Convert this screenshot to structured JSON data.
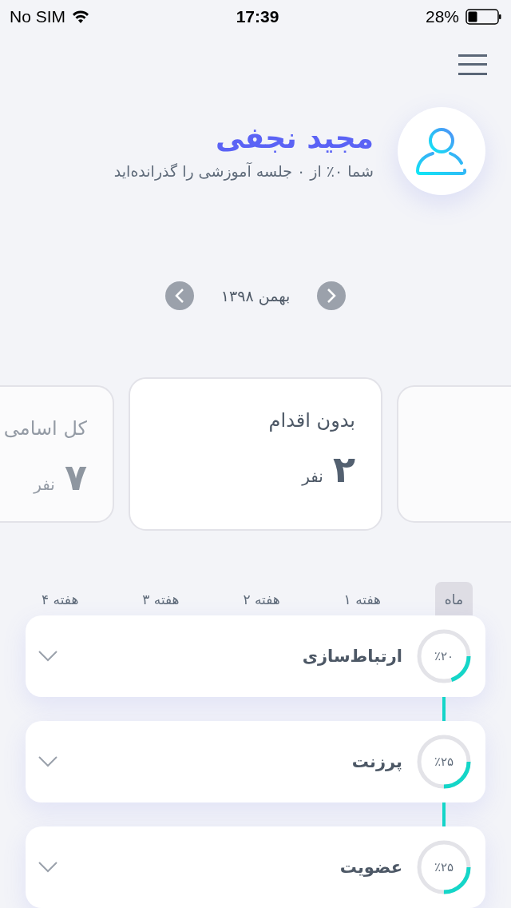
{
  "status_bar": {
    "carrier": "No SIM",
    "time": "17:39",
    "battery": "28%"
  },
  "profile": {
    "name": "مجید نجفی",
    "subtitle": "شما ۰٪ از ۰ جلسه آموزشی را گذرانده‌اید"
  },
  "month_nav": {
    "label": "بهمن ۱۳۹۸"
  },
  "cards": [
    {
      "title": "بدون اقدام",
      "count": "۲",
      "unit": "نفر",
      "selected": true
    },
    {
      "title": "کل اسامی",
      "count": "۷",
      "unit": "نفر",
      "selected": false
    }
  ],
  "tabs": [
    {
      "label": "ماه",
      "selected": true
    },
    {
      "label": "هفته ۱",
      "selected": false
    },
    {
      "label": "هفته ۲",
      "selected": false
    },
    {
      "label": "هفته ۳",
      "selected": false
    },
    {
      "label": "هفته ۴",
      "selected": false
    }
  ],
  "skills": [
    {
      "title": "ارتباط‌سازی",
      "percent": "٪۲۰",
      "level": 0.2
    },
    {
      "title": "پرزنت",
      "percent": "٪۲۵",
      "level": 0.25
    },
    {
      "title": "عضویت",
      "percent": "٪۲۵",
      "level": 0.25
    }
  ]
}
